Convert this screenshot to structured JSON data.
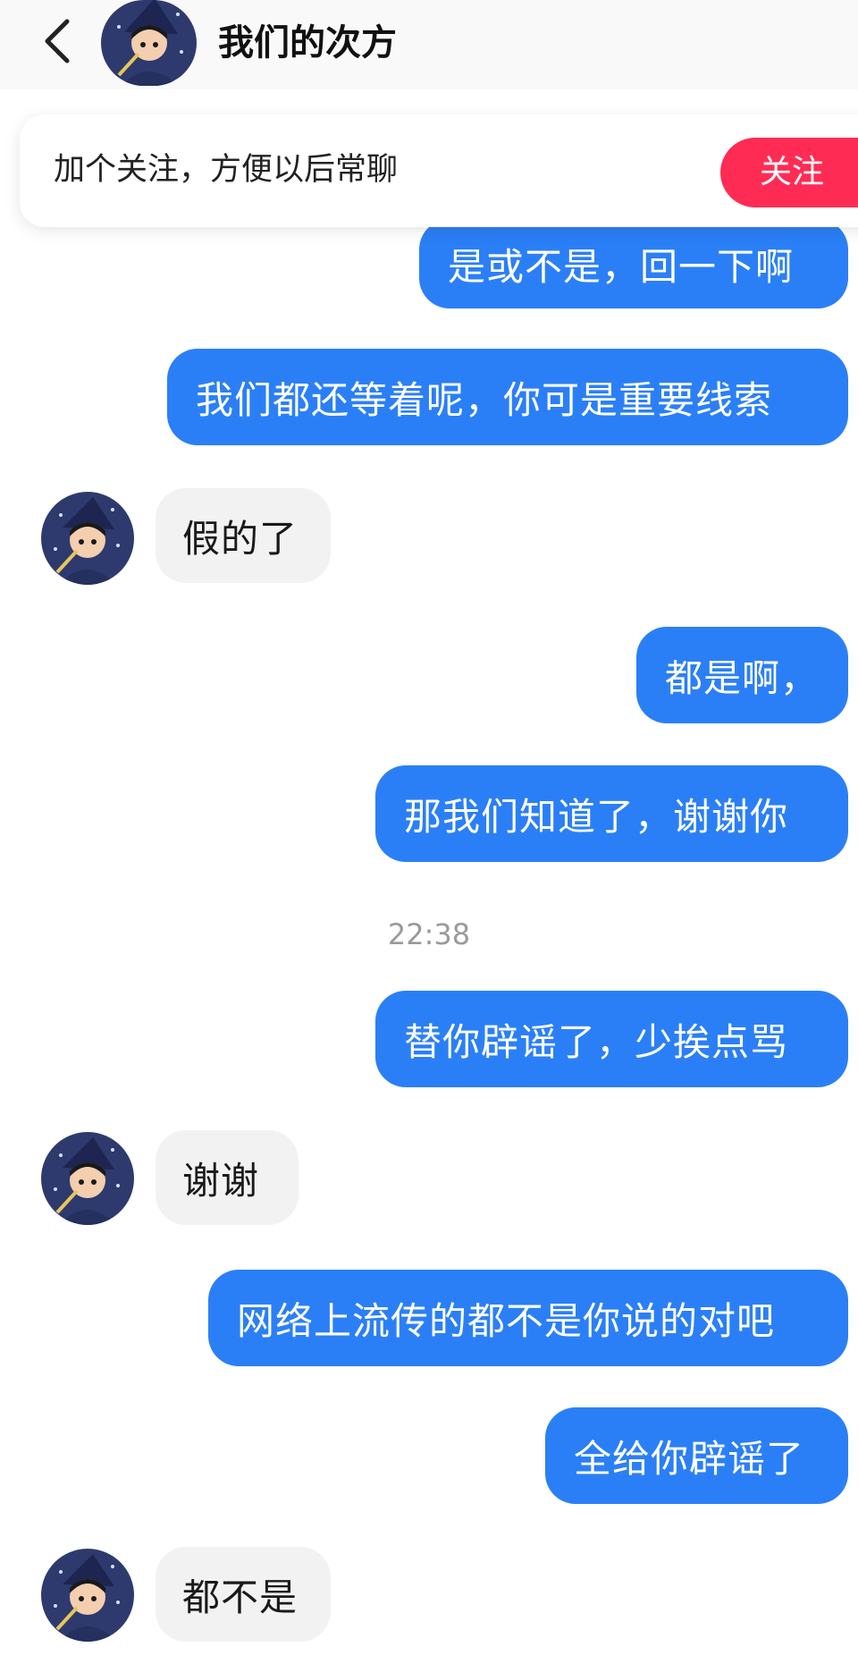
{
  "header": {
    "title": "我们的次方",
    "back_icon": "chevron-left-icon"
  },
  "follow_card": {
    "text": "加个关注，方便以后常聊",
    "button_label": "关注",
    "button_color": "#fe2c55"
  },
  "messages": [
    {
      "side": "out",
      "text": "是或不是，回一下啊"
    },
    {
      "side": "out",
      "text": "我们都还等着呢，你可是重要线索"
    },
    {
      "side": "in",
      "text": "假的了"
    },
    {
      "side": "out",
      "text": "都是啊，"
    },
    {
      "side": "out",
      "text": "那我们知道了，谢谢你"
    },
    {
      "side": "out",
      "text": "替你辟谣了，少挨点骂"
    },
    {
      "side": "in",
      "text": "谢谢"
    },
    {
      "side": "out",
      "text": "网络上流传的都不是你说的对吧"
    },
    {
      "side": "out",
      "text": "全给你辟谣了"
    },
    {
      "side": "in",
      "text": "都不是"
    }
  ],
  "timestamp": "22:38",
  "colors": {
    "outgoing_bubble": "#2b7ff6",
    "incoming_bubble": "#f2f2f2"
  }
}
